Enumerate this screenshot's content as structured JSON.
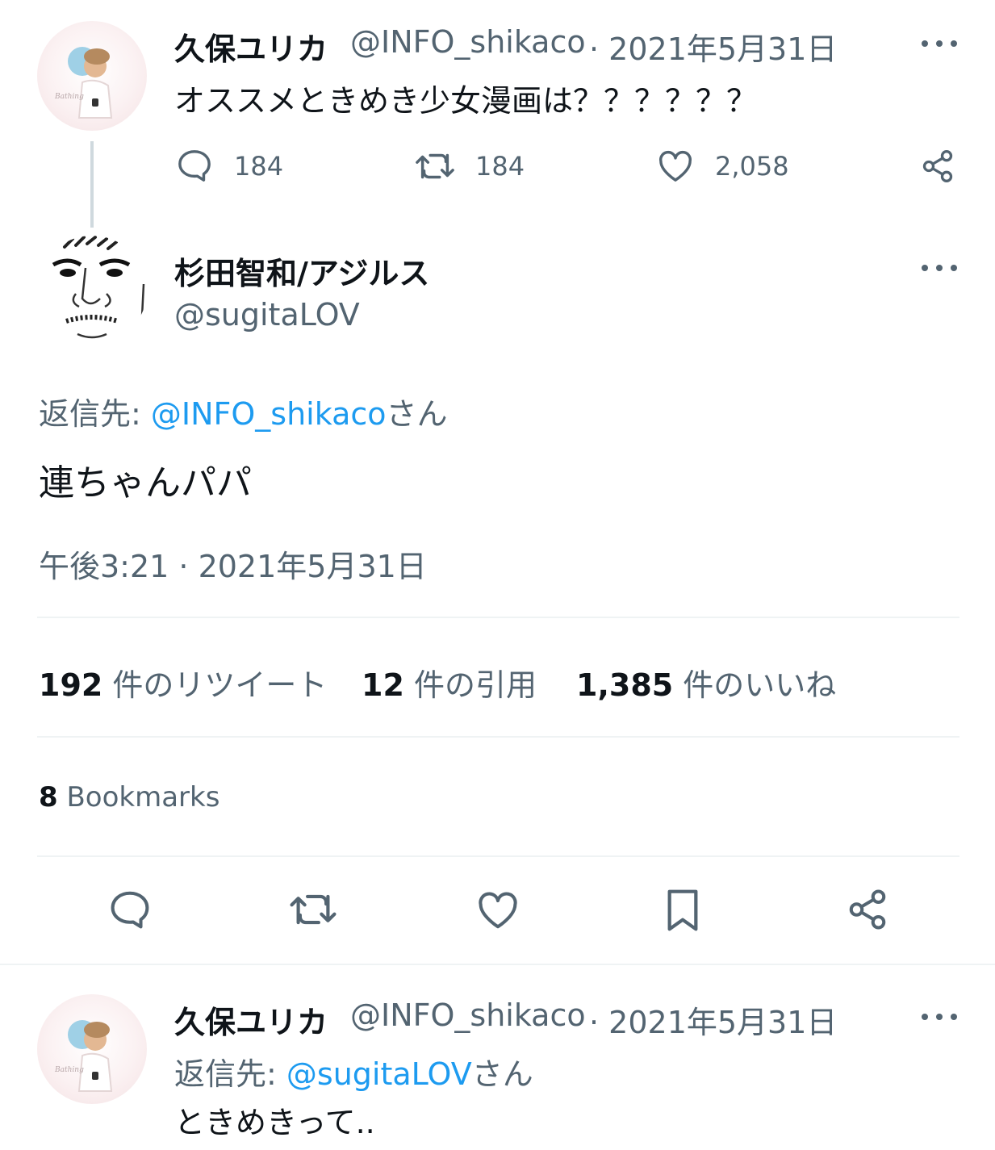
{
  "parent_tweet": {
    "name": "久保ユリカ",
    "handle": "@INFO_shikaco",
    "date": "· 2021年5月31日",
    "text": "オススメときめき少女漫画は？？？？？？",
    "reply_count": "184",
    "retweet_count": "184",
    "like_count": "2,058"
  },
  "main_tweet": {
    "name": "杉田智和/アジルス",
    "handle": "@sugitaLOV",
    "reply_prefix": "返信先: ",
    "reply_to": "@INFO_shikaco",
    "reply_suffix": "さん",
    "text": "連ちゃんパパ",
    "timestamp": "午後3:21 · 2021年5月31日",
    "stats": {
      "retweets_num": "192",
      "retweets_label": "件のリツイート",
      "quotes_num": "12",
      "quotes_label": "件の引用",
      "likes_num": "1,385",
      "likes_label": "件のいいね"
    },
    "bookmarks_num": "8",
    "bookmarks_label": "Bookmarks"
  },
  "reply_tweet": {
    "name": "久保ユリカ",
    "handle": "@INFO_shikaco",
    "date": "· 2021年5月31日",
    "reply_prefix": "返信先: ",
    "reply_to": "@sugitaLOV",
    "reply_suffix": "さん",
    "text": "ときめきって.."
  },
  "colors": {
    "text": "#0f1419",
    "muted": "#536471",
    "link": "#1d9bf0",
    "divider": "#eff3f4"
  },
  "icons": [
    "more-icon",
    "reply-icon",
    "retweet-icon",
    "like-icon",
    "share-icon",
    "bookmark-icon"
  ]
}
